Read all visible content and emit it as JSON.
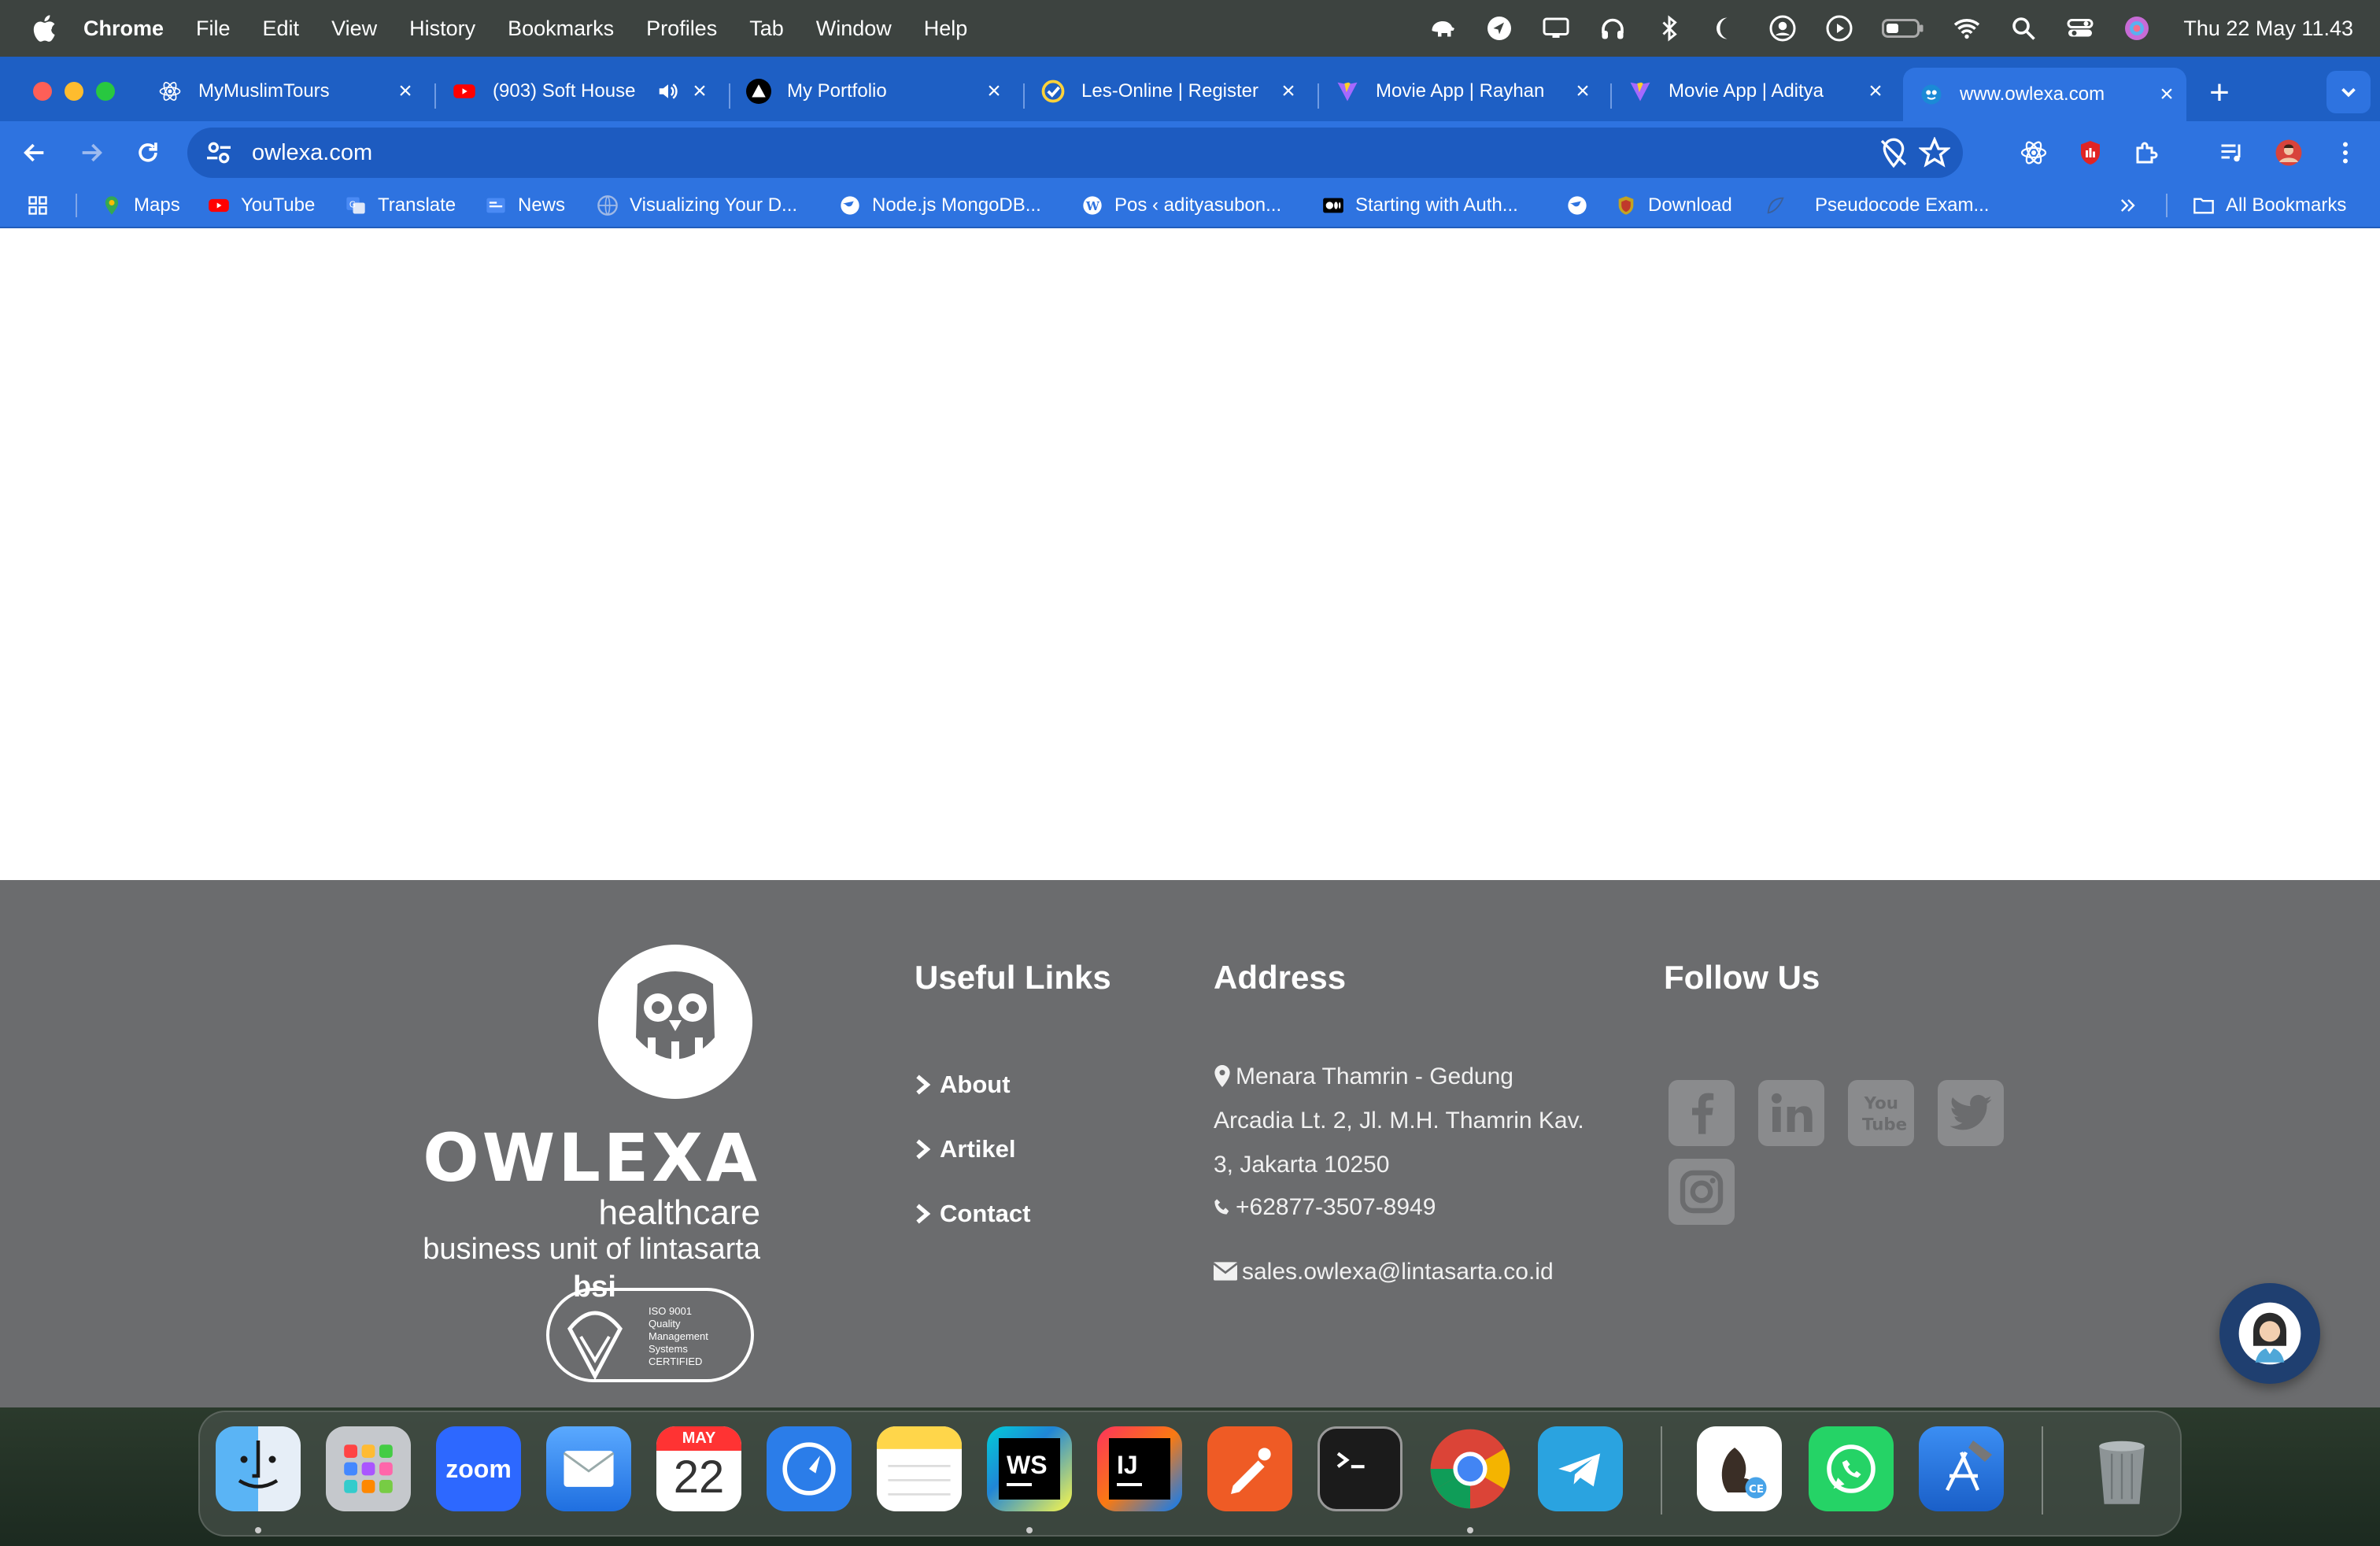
{
  "menubar": {
    "app_name": "Chrome",
    "menus": [
      "File",
      "Edit",
      "View",
      "History",
      "Bookmarks",
      "Profiles",
      "Tab",
      "Window",
      "Help"
    ],
    "clock": "Thu 22 May  11.43",
    "status_icons": [
      "elephant-icon",
      "navigation-icon",
      "display-icon",
      "headphones-icon",
      "bluetooth-icon",
      "moon-icon",
      "user-circle-icon",
      "play-circle-icon",
      "battery-icon",
      "wifi-icon",
      "search-icon",
      "control-center-icon",
      "siri-icon"
    ]
  },
  "tabs": [
    {
      "title": "MyMuslimTours",
      "icon": "react-icon"
    },
    {
      "title": "(903) Soft House",
      "icon": "youtube-icon",
      "audio": true
    },
    {
      "title": "My Portfolio",
      "icon": "triangle-logo-icon"
    },
    {
      "title": "Les-Online | Register",
      "icon": "check-circle-icon"
    },
    {
      "title": "Movie App | Rayhan",
      "icon": "vite-icon"
    },
    {
      "title": "Movie App | Aditya",
      "icon": "vite-icon"
    },
    {
      "title": "www.owlexa.com",
      "icon": "owlexa-icon",
      "active": true
    }
  ],
  "address_bar": {
    "url": "owlexa.com"
  },
  "bookmarks": [
    {
      "label": "",
      "icon": "apps-grid-icon"
    },
    {
      "label": "Maps",
      "icon": "maps-pin-icon"
    },
    {
      "label": "YouTube",
      "icon": "youtube-icon"
    },
    {
      "label": "Translate",
      "icon": "translate-icon"
    },
    {
      "label": "News",
      "icon": "news-icon"
    },
    {
      "label": "Visualizing Your D...",
      "icon": "globe-icon"
    },
    {
      "label": "Node.js MongoDB...",
      "icon": "globe-icon"
    },
    {
      "label": "Pos ‹ adityasubon...",
      "icon": "wordpress-icon"
    },
    {
      "label": "Starting with Auth...",
      "icon": "medium-icon"
    },
    {
      "label": "",
      "icon": "globe-icon"
    },
    {
      "label": "Download",
      "icon": "shield-icon"
    },
    {
      "label": "Pseudocode Exam...",
      "icon": "feather-icon"
    },
    {
      "label": "All Bookmarks",
      "icon": "folder-icon"
    }
  ],
  "footer": {
    "logo": {
      "wordmark": "OWLEXA",
      "tagline": "healthcare",
      "business_unit": "business unit of lintasarta",
      "certification": "ISO 9001 Quality Management Systems CERTIFIED",
      "cert_brand": "bsi"
    },
    "useful_links": {
      "heading": "Useful Links",
      "items": [
        "About",
        "Artikel",
        "Contact"
      ]
    },
    "address": {
      "heading": "Address",
      "lines": [
        "Menara Thamrin - Gedung",
        "Arcadia Lt. 2, Jl. M.H. Thamrin Kav.",
        "3, Jakarta 10250"
      ],
      "phone": "+62877-3507-8949",
      "email": "sales.owlexa@lintasarta.co.id"
    },
    "follow": {
      "heading": "Follow Us",
      "networks": [
        "facebook",
        "linkedin",
        "youtube",
        "twitter",
        "instagram"
      ]
    }
  },
  "dock": {
    "apps": [
      "Finder",
      "Launchpad",
      "Zoom",
      "Mail",
      "Calendar",
      "Safari-like",
      "Notes",
      "WebStorm",
      "IntelliJ IDEA",
      "Postman",
      "Terminal",
      "Chrome",
      "Telegram",
      "TablePlus",
      "WhatsApp",
      "Xcode",
      "Trash"
    ],
    "calendar_month": "MAY",
    "calendar_day": "22",
    "zoom_label": "zoom",
    "ws_label": "WS",
    "ij_label": "IJ"
  },
  "colors": {
    "tab_strip": "#1e5fc4",
    "toolbar": "#2e73e0",
    "footer_bg": "#6b6c6e"
  }
}
